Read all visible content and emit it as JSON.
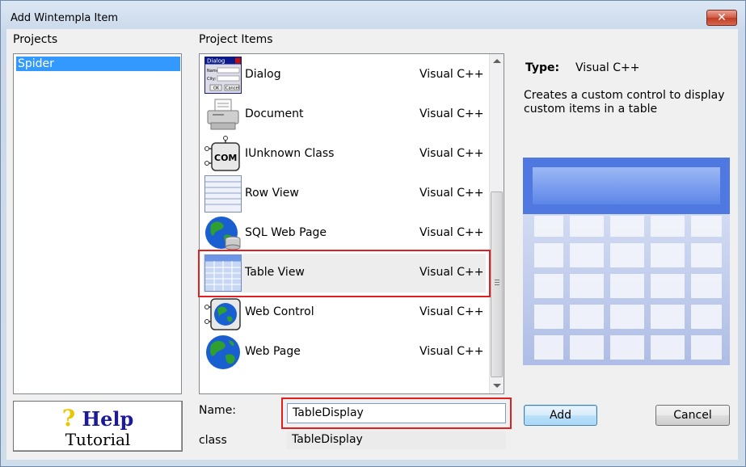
{
  "window": {
    "title": "Add Wintempla Item",
    "close_label": "✕"
  },
  "projects": {
    "label": "Projects",
    "items": [
      "Spider"
    ]
  },
  "project_items": {
    "label": "Project Items",
    "items": [
      {
        "name": "Dialog",
        "type": "Visual C++",
        "icon": "dialog-icon"
      },
      {
        "name": "Document",
        "type": "Visual C++",
        "icon": "printer-icon"
      },
      {
        "name": "IUnknown Class",
        "type": "Visual C++",
        "icon": "com-icon"
      },
      {
        "name": "Row View",
        "type": "Visual C++",
        "icon": "row-view-icon"
      },
      {
        "name": "SQL Web Page",
        "type": "Visual C++",
        "icon": "globe-database-icon"
      },
      {
        "name": "Table View",
        "type": "Visual C++",
        "icon": "table-view-icon"
      },
      {
        "name": "Web Control",
        "type": "Visual C++",
        "icon": "web-control-icon"
      },
      {
        "name": "Web Page",
        "type": "Visual C++",
        "icon": "globe-icon"
      }
    ],
    "selected": "Table View"
  },
  "dialog_icon_text": {
    "title": "Dialog",
    "name": "Name:",
    "city": "City:",
    "ok": "OK",
    "cancel": "Cancel"
  },
  "com_icon_text": "COM",
  "details": {
    "type_label": "Type:",
    "type_value": "Visual C++",
    "description": "Creates a custom control to display custom items in a table"
  },
  "form": {
    "name_label": "Name:",
    "name_value": "TableDisplay",
    "class_label": "class",
    "class_value": "TableDisplay"
  },
  "help": {
    "line1": "Help",
    "q": "?",
    "line2": "Tutorial"
  },
  "buttons": {
    "add": "Add",
    "cancel": "Cancel"
  },
  "colors": {
    "selection": "#3399ff",
    "highlight": "#e02020"
  }
}
